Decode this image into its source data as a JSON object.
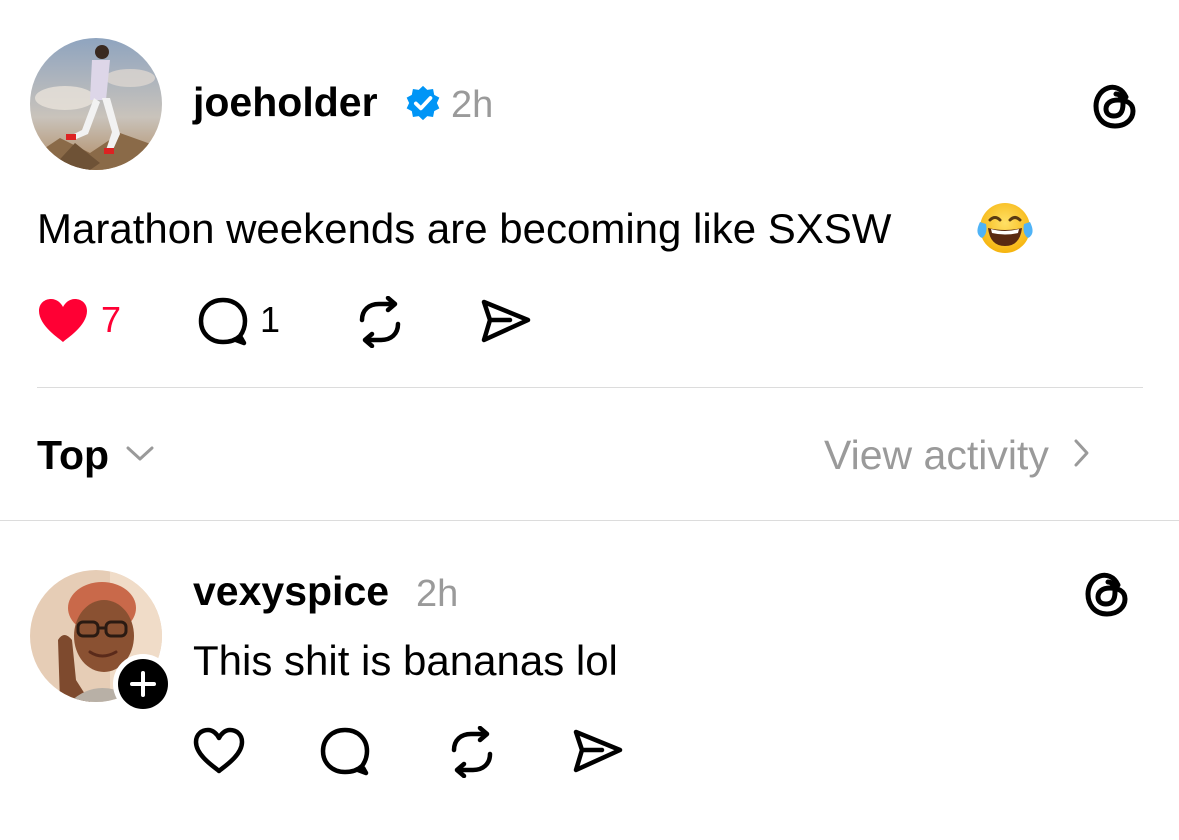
{
  "post": {
    "username": "joeholder",
    "time": "2h",
    "text": "Marathon weekends are becoming like SXSW",
    "emoji": "😂",
    "likes": "7",
    "replies": "1",
    "liked": true,
    "verified": true
  },
  "filter": {
    "sort_label": "Top",
    "view_activity_label": "View activity"
  },
  "reply": {
    "username": "vexyspice",
    "time": "2h",
    "text": "This shit is bananas lol"
  },
  "icons": {
    "verified": "verified-badge-icon",
    "threads": "threads-logo-icon",
    "like": "heart-icon",
    "reply": "comment-icon",
    "repost": "repost-icon",
    "share": "send-icon",
    "follow": "plus-icon",
    "sort": "chevron-down-icon",
    "activity": "chevron-right-icon"
  },
  "colors": {
    "like_red": "#ff0034",
    "verified_blue": "#0095f6",
    "secondary_gray": "#9a9a9a"
  }
}
